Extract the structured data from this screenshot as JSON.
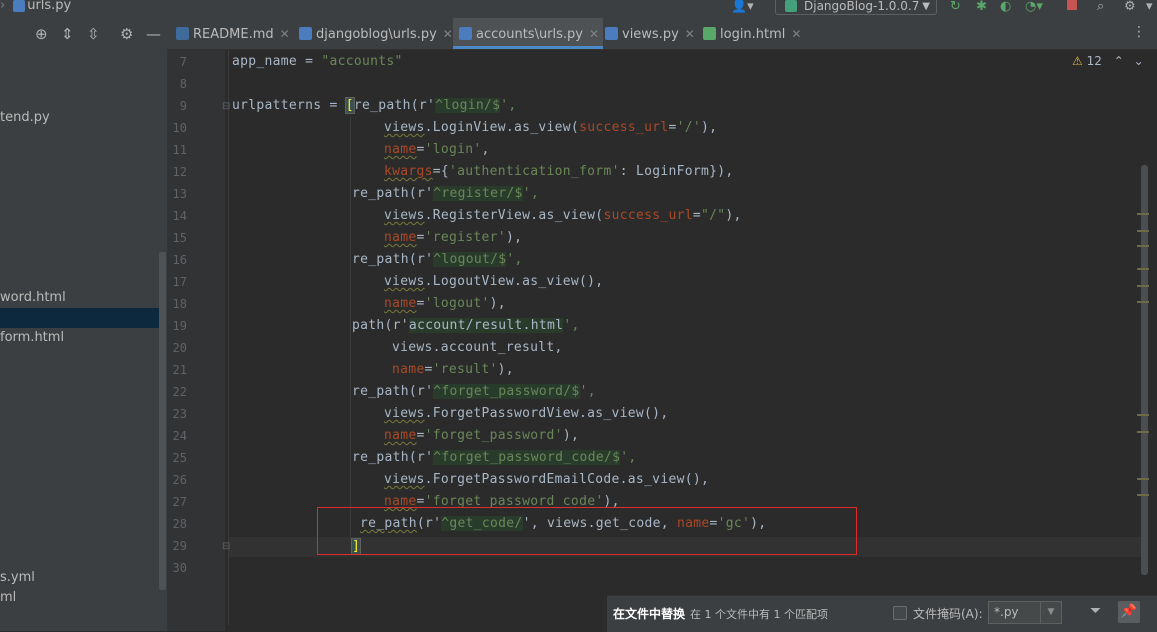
{
  "breadcrumb": {
    "file": "urls.py"
  },
  "toolbar": {
    "run_config": "DjangoBlog-1.0.0.7"
  },
  "project_panel": {
    "items": [
      "tend.py",
      "word.html",
      "form.html",
      "s.yml",
      "ml"
    ]
  },
  "tabs": [
    {
      "label": "README.md",
      "icon": "markdown-file-icon"
    },
    {
      "label": "djangoblog\\urls.py",
      "icon": "python-file-icon"
    },
    {
      "label": "accounts\\urls.py",
      "icon": "python-file-icon",
      "active": true
    },
    {
      "label": "views.py",
      "icon": "python-file-icon"
    },
    {
      "label": "login.html",
      "icon": "html-file-icon"
    }
  ],
  "editor": {
    "inspection_count": "12",
    "line_numbers": [
      "7",
      "8",
      "9",
      "10",
      "11",
      "12",
      "13",
      "14",
      "15",
      "16",
      "17",
      "18",
      "19",
      "20",
      "21",
      "22",
      "23",
      "24",
      "25",
      "26",
      "27",
      "28",
      "29",
      "30"
    ],
    "lines": {
      "l7": {
        "a": "app_name = ",
        "b": "\"accounts\""
      },
      "l9": {
        "a": "urlpatterns = ",
        "b": "[",
        "c": "re_path(r'",
        "d": "^login/$",
        "e": "',"
      },
      "l10": {
        "a": "views",
        "b": ".LoginView.as_view(",
        "c": "success_url",
        "d": "=",
        "e": "'/'",
        "f": "),"
      },
      "l11": {
        "a": "name",
        "b": "=",
        "c": "'login'",
        "d": ","
      },
      "l12": {
        "a": "kwargs",
        "b": "={",
        "c": "'authentication_form'",
        "d": ": LoginForm}),"
      },
      "l13": {
        "a": "re_path(r'",
        "b": "^register/$",
        "c": "',"
      },
      "l14": {
        "a": "views",
        "b": ".RegisterView.as_view(",
        "c": "success_url",
        "d": "=",
        "e": "\"/\"",
        "f": "),"
      },
      "l15": {
        "a": "name",
        "b": "=",
        "c": "'register'",
        "d": "),"
      },
      "l16": {
        "a": "re_path(r'",
        "b": "^logout/$",
        "c": "',"
      },
      "l17": {
        "a": "views",
        "b": ".LogoutView.as_view(),"
      },
      "l18": {
        "a": "name",
        "b": "=",
        "c": "'logout'",
        "d": "),"
      },
      "l19": {
        "a": "path(r'",
        "b": "account/result.html",
        "c": "',"
      },
      "l20": {
        "a": "views.account_result,"
      },
      "l21": {
        "a": "name",
        "b": "=",
        "c": "'result'",
        "d": "),"
      },
      "l22": {
        "a": "re_path(r'",
        "b": "^forget_password/$",
        "c": "',"
      },
      "l23": {
        "a": "views",
        "b": ".ForgetPasswordView.as_view(),"
      },
      "l24": {
        "a": "name",
        "b": "=",
        "c": "'forget_password'",
        "d": "),"
      },
      "l25": {
        "a": "re_path(r'",
        "b": "^forget_password_code/$",
        "c": "',"
      },
      "l26": {
        "a": "views",
        "b": ".ForgetPasswordEmailCode.as_view(),"
      },
      "l27": {
        "a": "name",
        "b": "=",
        "c": "'forget_password_code'",
        "d": "),"
      },
      "l28": {
        "a": "re_path",
        "b": "(r'",
        "c": "^get_code/",
        "d": "', views.get_code, ",
        "e": "name",
        "f": "=",
        "g": "'gc'",
        "h": "),"
      },
      "l29": {
        "a": "]"
      }
    }
  },
  "replace_bar": {
    "title": "在文件中替换",
    "info": "在 1 个文件中有 1 个匹配项",
    "file_mask_label": "文件掩码(A):",
    "file_mask_value": "*.py"
  },
  "colors": {
    "accent": "#4a88c7",
    "highlight_box": "#e02b2b"
  }
}
